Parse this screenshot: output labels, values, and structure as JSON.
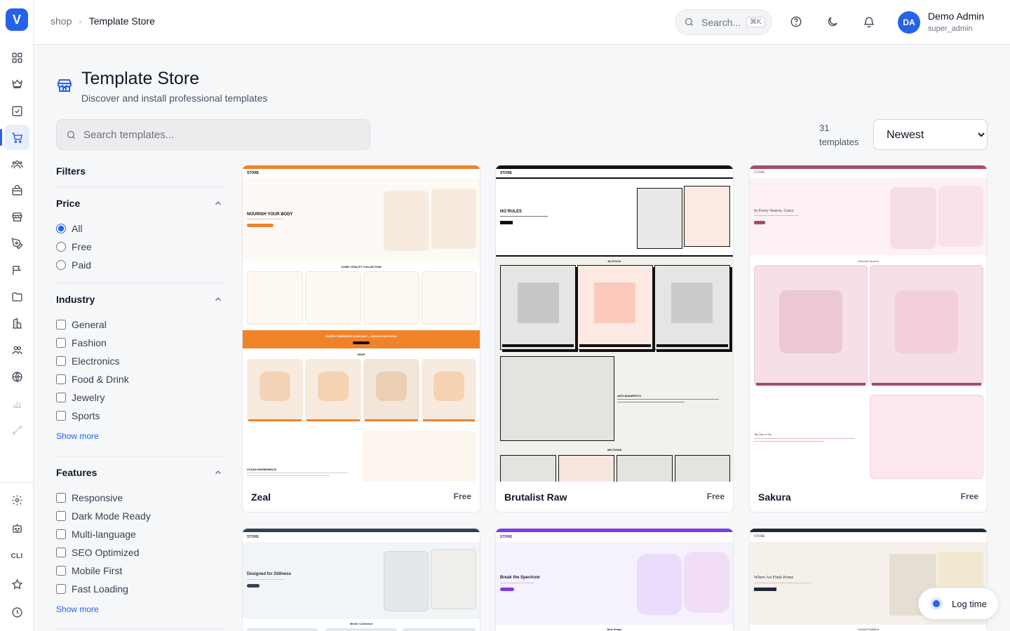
{
  "app": {
    "logo_letter": "V"
  },
  "breadcrumb": {
    "parent": "shop",
    "current": "Template Store"
  },
  "header": {
    "search_placeholder": "Search...",
    "search_shortcut": "⌘K"
  },
  "user": {
    "initials": "DA",
    "name": "Demo Admin",
    "role": "super_admin"
  },
  "sidebar": {
    "cli_label": "CLI"
  },
  "page": {
    "title": "Template Store",
    "subtitle": "Discover and install professional templates",
    "search_placeholder": "Search templates...",
    "count_number": "31",
    "count_label": "templates",
    "sort_selected": "Newest"
  },
  "filters": {
    "title": "Filters",
    "price": {
      "title": "Price",
      "options": [
        "All",
        "Free",
        "Paid"
      ],
      "selected": "All"
    },
    "industry": {
      "title": "Industry",
      "options": [
        "General",
        "Fashion",
        "Electronics",
        "Food & Drink",
        "Jewelry",
        "Sports"
      ],
      "show_more": "Show more"
    },
    "features": {
      "title": "Features",
      "options": [
        "Responsive",
        "Dark Mode Ready",
        "Multi-language",
        "SEO Optimized",
        "Mobile First",
        "Fast Loading"
      ],
      "show_more": "Show more"
    }
  },
  "templates": [
    {
      "name": "Zeal",
      "price": "Free",
      "accent": "#f0832a"
    },
    {
      "name": "Brutalist Raw",
      "price": "Free",
      "accent": "#111111"
    },
    {
      "name": "Sakura",
      "price": "Free",
      "accent": "#a64b6e"
    },
    {
      "name": "",
      "price": "",
      "accent": "#334155"
    },
    {
      "name": "",
      "price": "",
      "accent": "#7c3aed"
    },
    {
      "name": "",
      "price": "",
      "accent": "#1f2937"
    }
  ],
  "previews": {
    "zeal": {
      "brand": "STORE",
      "hero": "NOURISH YOUR BODY",
      "section1": "CORE VITALITY COLLECTION",
      "banner": "HURRY! ENERGIZE YOUR DAY — DEALS END SOON",
      "section2": "SHOP",
      "section3": "CLEAN INGREDIENTS"
    },
    "brutalist": {
      "brand": "STORE",
      "hero": "NO RULES",
      "section1": "IN STOCK",
      "section2": "ANTI-MANIFESTO",
      "section3": "SECTIONS"
    },
    "sakura": {
      "brand": "STORE",
      "hero": "In Every Season, Grace",
      "section1": "Seasonal Curation",
      "section2": "The Way of Tea"
    },
    "stillness": {
      "brand": "STORE",
      "hero": "Designed for Stillness",
      "section1": "Winter Collection"
    },
    "spectrum": {
      "brand": "STORE",
      "hero": "Break the Spectrum",
      "section1": "New Drops"
    },
    "art": {
      "brand": "STORE",
      "hero": "Where Art Finds Home",
      "section1": "Curated Exhibition"
    }
  },
  "log_time": {
    "label": "Log time"
  }
}
